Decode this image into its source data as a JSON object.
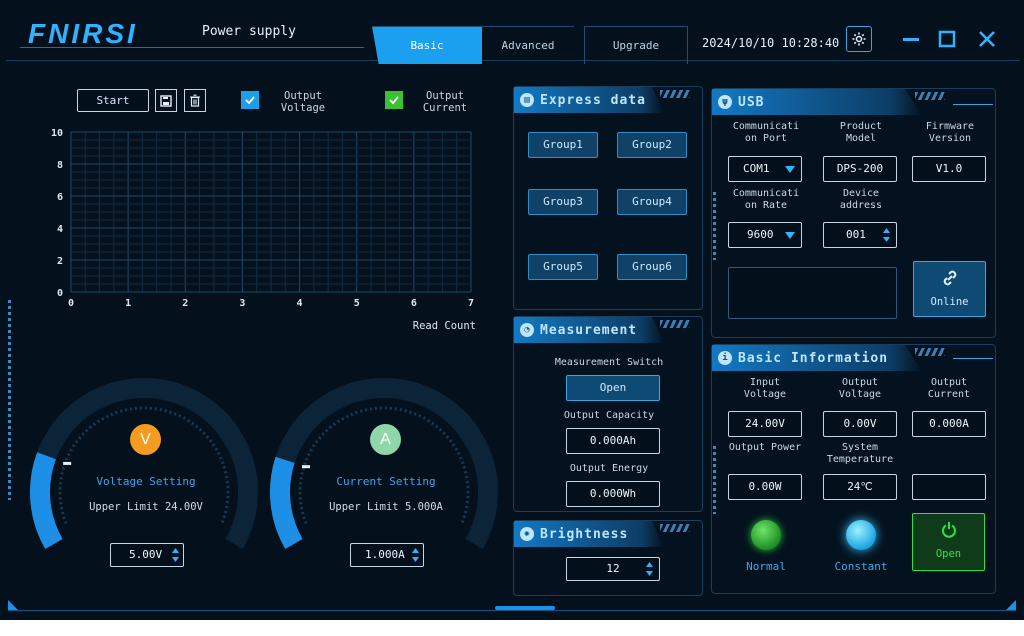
{
  "titlebar": {
    "logo": "FNIRSI",
    "title": "Power supply",
    "tabs": [
      {
        "label": "Basic",
        "active": true
      },
      {
        "label": "Advanced",
        "active": false
      },
      {
        "label": "Upgrade",
        "active": false
      }
    ],
    "datetime": "2024/10/10 10:28:40"
  },
  "colors": {
    "accent": "#1aa0ef",
    "voltage": "#f39c1f",
    "current": "#8fd6a8",
    "normal": "#2fbf3a",
    "constant": "#38c8ff",
    "open": "#2ee04a"
  },
  "chart_controls": {
    "start": "Start",
    "output_voltage": "Output Voltage",
    "output_current": "Output Current",
    "output_voltage_checked": true,
    "output_current_checked": true
  },
  "chart_data": {
    "type": "line",
    "series": [],
    "xlabel": "Read Count",
    "ylabel": "",
    "xlim": [
      0,
      7
    ],
    "ylim": [
      0,
      10
    ],
    "x_ticks": [
      0,
      1,
      2,
      3,
      4,
      5,
      6,
      7
    ],
    "y_ticks": [
      0,
      2,
      4,
      6,
      8,
      10
    ],
    "grid": true
  },
  "voltage_dial": {
    "badge": "V",
    "title": "Voltage Setting",
    "limit": "Upper Limit 24.00V",
    "value": "5.00V",
    "level": 0.21
  },
  "current_dial": {
    "badge": "A",
    "title": "Current Setting",
    "limit": "Upper Limit 5.000A",
    "value": "1.000A",
    "level": 0.2
  },
  "express": {
    "title": "Express data",
    "groups": [
      "Group1",
      "Group2",
      "Group3",
      "Group4",
      "Group5",
      "Group6"
    ]
  },
  "measurement": {
    "title": "Measurement",
    "switch_label": "Measurement Switch",
    "switch_button": "Open",
    "capacity_label": "Output Capacity",
    "capacity": "0.000Ah",
    "energy_label": "Output Energy",
    "energy": "0.000Wh"
  },
  "brightness": {
    "title": "Brightness",
    "value": "12"
  },
  "usb": {
    "title": "USB",
    "port_label": "Communicati on Port",
    "model_label": "Product Model",
    "firmware_label": "Firmware Version",
    "port": "COM1",
    "model": "DPS-200",
    "firmware": "V1.0",
    "rate_label": "Communicati on Rate",
    "address_label": "Device address",
    "rate": "9600",
    "address": "001",
    "online": "Online"
  },
  "basic": {
    "title": "Basic Information",
    "in_v_label": "Input Voltage",
    "out_v_label": "Output Voltage",
    "out_c_label": "Output Current",
    "in_v": "24.00V",
    "out_v": "0.00V",
    "out_c": "0.000A",
    "power_label": "Output Power",
    "temp_label": "System Temperature",
    "power": "0.00W",
    "temp": "24℃",
    "normal": "Normal",
    "constant": "Constant",
    "open": "Open"
  }
}
